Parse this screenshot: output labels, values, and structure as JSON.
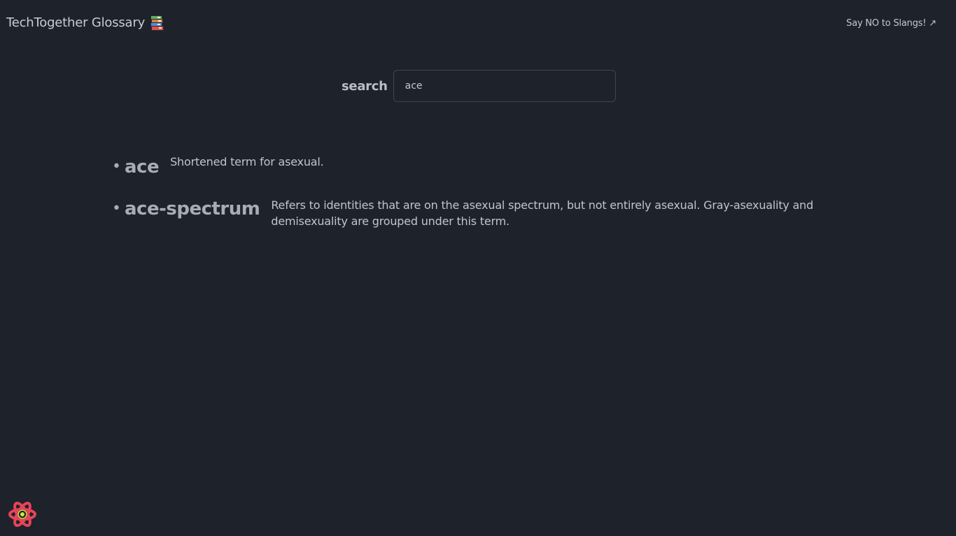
{
  "header": {
    "title": "TechTogether Glossary",
    "title_icon": "books-icon",
    "link_label": "Say NO to Slangs! ↗"
  },
  "search": {
    "label": "search",
    "value": "ace",
    "placeholder": ""
  },
  "results": [
    {
      "term": "ace",
      "definition": "Shortened term for asexual."
    },
    {
      "term": "ace-spectrum",
      "definition": "Refers to identities that are on the asexual spectrum, but not entirely asexual. Gray-asexuality and demisexuality are grouped under this term."
    }
  ],
  "footer": {
    "logo_icon": "react-logo-icon"
  },
  "colors": {
    "background": "#1e222a",
    "text": "#c3c7cf",
    "term": "#a7adb7",
    "input_border": "#3f4552",
    "logo_primary": "#e8435b",
    "logo_accent": "#d6e341"
  }
}
